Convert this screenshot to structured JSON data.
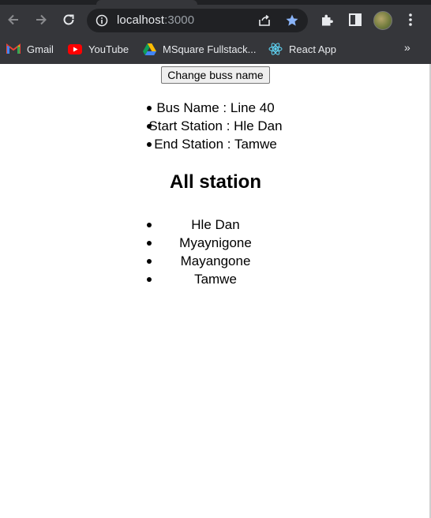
{
  "browser": {
    "url_host": "localhost",
    "url_port": ":3000",
    "bookmarks": [
      {
        "label": "Gmail",
        "icon": "gmail-icon"
      },
      {
        "label": "YouTube",
        "icon": "youtube-icon"
      },
      {
        "label": "MSquare Fullstack...",
        "icon": "google-drive-icon"
      },
      {
        "label": "React App",
        "icon": "react-icon"
      }
    ],
    "bookmarks_more": "»"
  },
  "page": {
    "change_button_label": "Change buss name",
    "bus_info": [
      "Bus Name : Line 40",
      "Start Station : Hle Dan",
      "End Station : Tamwe"
    ],
    "stations_heading": "All station",
    "stations": [
      "Hle Dan",
      "Myaynigone",
      "Mayangone",
      "Tamwe"
    ]
  },
  "colors": {
    "chrome_bg": "#35363a",
    "omnibox_bg": "#202124",
    "star_accent": "#8ab4f8"
  }
}
